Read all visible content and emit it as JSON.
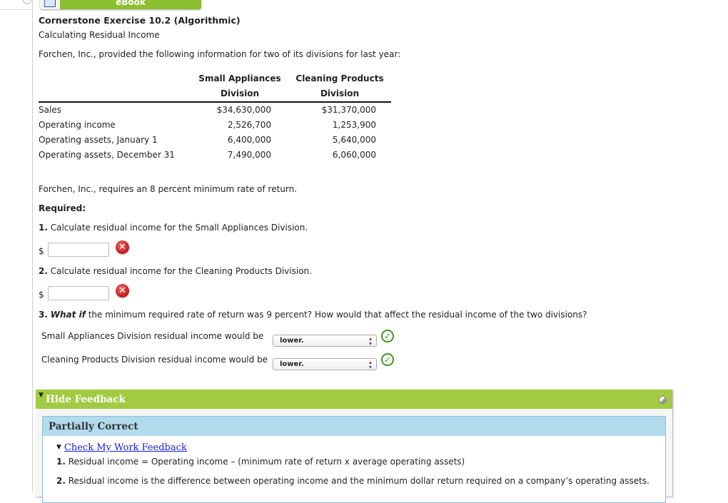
{
  "ebook": {
    "label": "eBook",
    "icon": "book-icon"
  },
  "exercise": {
    "title": "Cornerstone Exercise 10.2 (Algorithmic)",
    "subtitle": "Calculating Residual Income",
    "intro": "Forchen, Inc., provided the following information for two of its divisions for last year:"
  },
  "table": {
    "headers": [
      {
        "line1": "Small Appliances",
        "line2": "Division"
      },
      {
        "line1": "Cleaning Products",
        "line2": "Division"
      }
    ],
    "rows": [
      {
        "label": "Sales",
        "small_appliances": "$34,630,000",
        "cleaning_products": "$31,370,000"
      },
      {
        "label": "Operating income",
        "small_appliances": "2,526,700",
        "cleaning_products": "1,253,900"
      },
      {
        "label": "Operating assets, January 1",
        "small_appliances": "6,400,000",
        "cleaning_products": "5,640,000"
      },
      {
        "label": "Operating assets, December 31",
        "small_appliances": "7,490,000",
        "cleaning_products": "6,060,000"
      }
    ]
  },
  "requirement_text": "Forchen, Inc., requires an 8 percent minimum rate of return.",
  "required_label": "Required:",
  "questions": {
    "q1": {
      "num": "1.",
      "text": " Calculate residual income for the Small Appliances Division.",
      "currency": "$",
      "value": "",
      "status": "incorrect"
    },
    "q2": {
      "num": "2.",
      "text": " Calculate residual income for the Cleaning Products Division.",
      "currency": "$",
      "value": "",
      "status": "incorrect"
    },
    "q3": {
      "num": "3.",
      "emphasis": "What if",
      "text": " the minimum required rate of return was 9 percent? How would that affect the residual income of the two divisions?",
      "items": [
        {
          "label": "Small Appliances Division residual income would be",
          "selected": "lower.",
          "status": "correct"
        },
        {
          "label": "Cleaning Products Division residual income would be",
          "selected": "lower.",
          "status": "correct"
        }
      ]
    }
  },
  "feedback": {
    "toggle_label": "Hide Feedback",
    "status": "Partially Correct",
    "link_label": "Check My Work Feedback",
    "lines": [
      {
        "num": "1.",
        "text": " Residual income = Operating income – (minimum rate of return x average operating assets)"
      },
      {
        "num": "2.",
        "text": " Residual income is the difference between operating income and the minimum dollar return required on a company’s operating assets."
      }
    ]
  },
  "colors": {
    "green": "#a2cb43",
    "blue_header": "#b2dced",
    "link": "#1a1adb",
    "error": "#c01818",
    "correct": "#3b9a1e"
  }
}
